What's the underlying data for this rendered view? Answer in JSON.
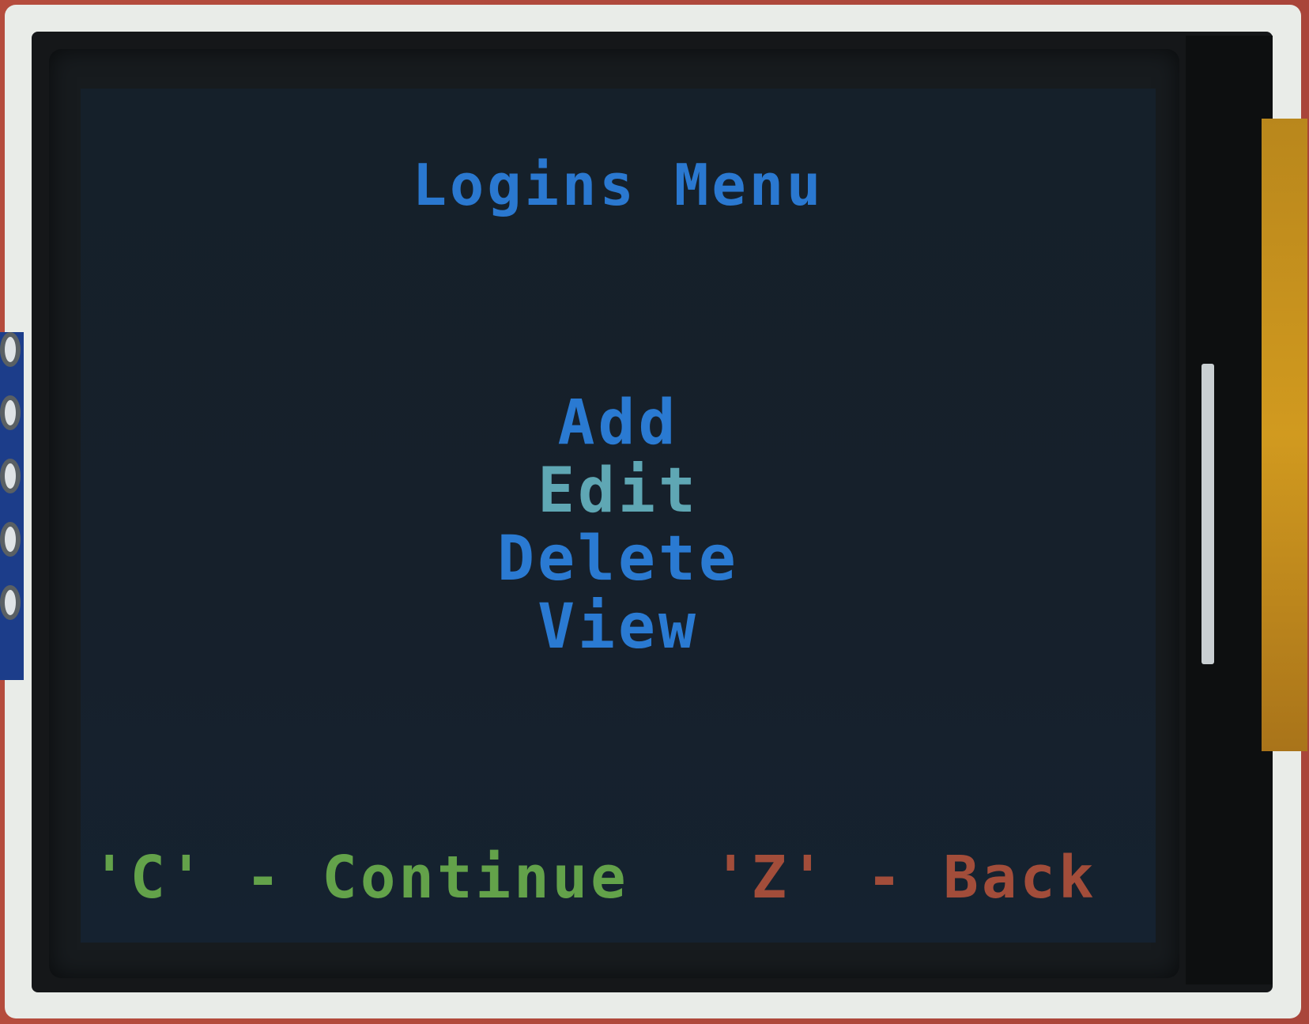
{
  "screen": {
    "title": "Logins Menu",
    "menu_items": [
      {
        "label": "Add",
        "selected": false
      },
      {
        "label": "Edit",
        "selected": true
      },
      {
        "label": "Delete",
        "selected": false
      },
      {
        "label": "View",
        "selected": false
      }
    ],
    "footer": {
      "continue_hint": "'C' - Continue",
      "back_hint": "'Z' - Back"
    }
  },
  "colors": {
    "title": "#2a78d0",
    "menu_item": "#2a7ad2",
    "menu_item_selected": "#5fa7b4",
    "continue_hint": "#63a24a",
    "back_hint": "#a24d3a",
    "screen_background": "#16202b"
  }
}
